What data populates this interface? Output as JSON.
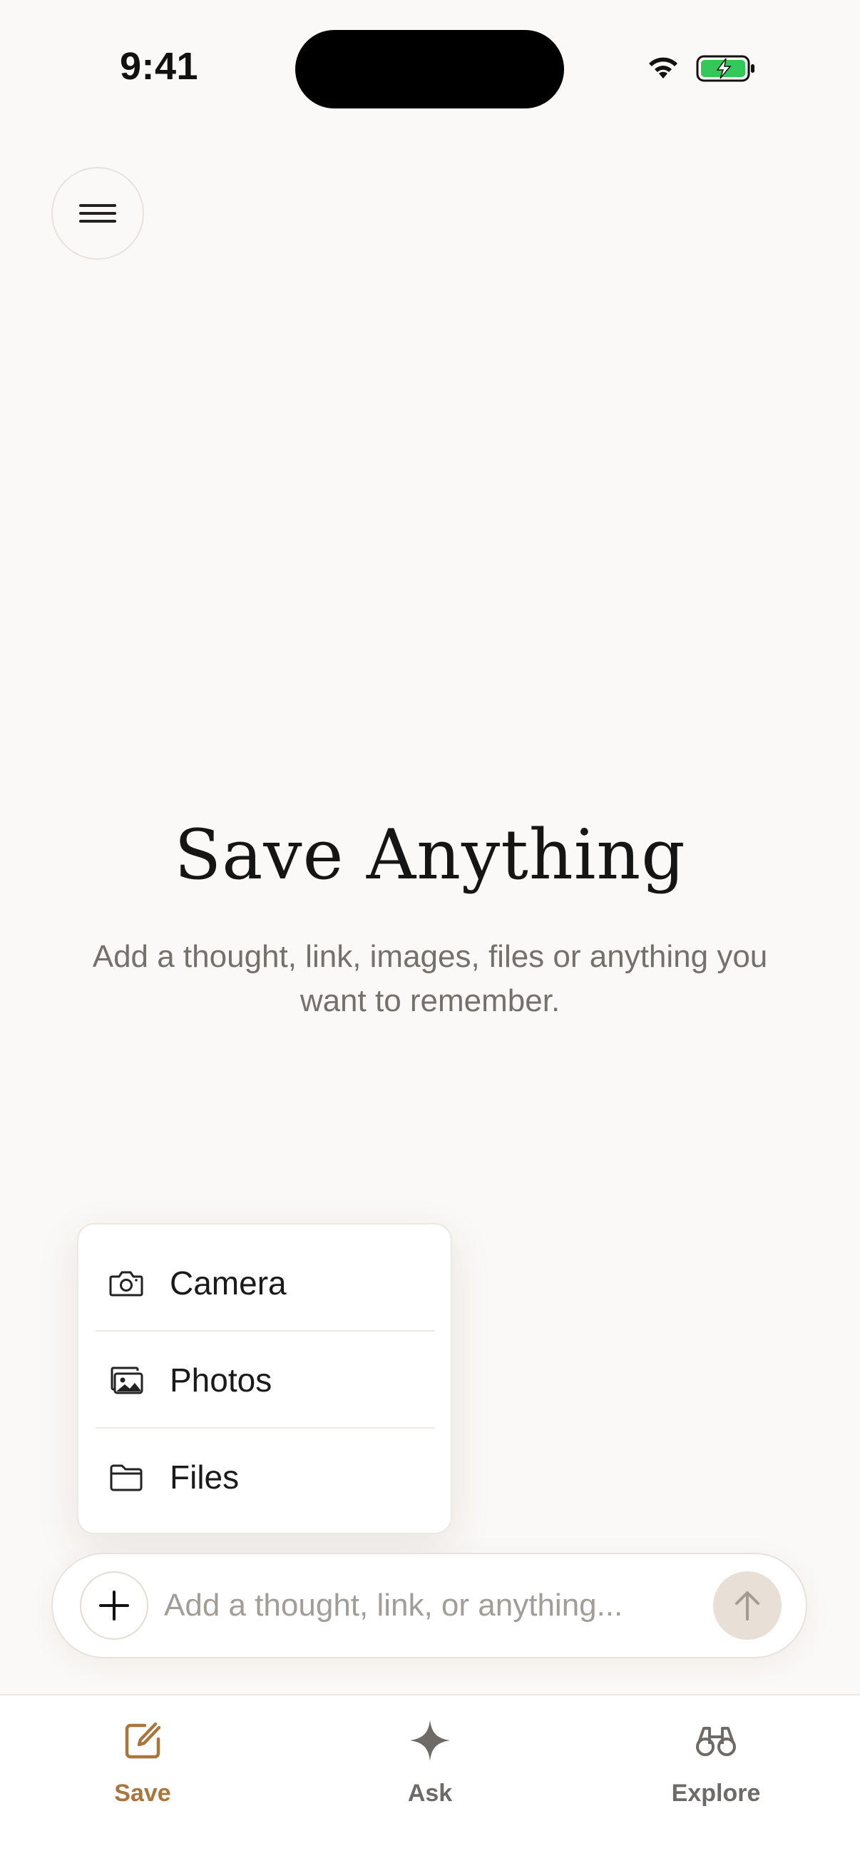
{
  "status_bar": {
    "time": "9:41"
  },
  "header": {
    "menu_icon": "hamburger-icon"
  },
  "hero": {
    "title": "Save Anything",
    "subtitle": "Add a thought, link, images, files or anything you want to remember."
  },
  "attach_menu": {
    "items": [
      {
        "label": "Camera",
        "icon": "camera-icon"
      },
      {
        "label": "Photos",
        "icon": "photos-icon"
      },
      {
        "label": "Files",
        "icon": "folder-icon"
      }
    ]
  },
  "composer": {
    "placeholder": "Add a thought, link, or anything...",
    "value": ""
  },
  "tab_bar": {
    "active": "Save",
    "tabs": [
      {
        "label": "Save",
        "icon": "compose-icon"
      },
      {
        "label": "Ask",
        "icon": "sparkle-icon"
      },
      {
        "label": "Explore",
        "icon": "binoculars-icon"
      }
    ]
  },
  "colors": {
    "background": "#fbf9f7",
    "accent": "#a9773d",
    "muted_text": "#74706c",
    "battery_charging": "#34c759"
  }
}
